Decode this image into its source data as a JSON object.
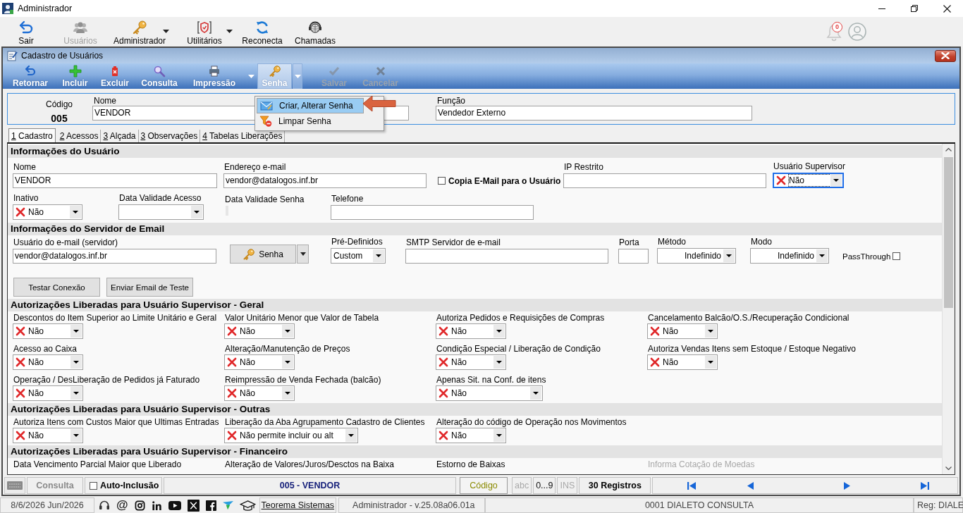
{
  "window": {
    "title": "Administrador"
  },
  "main_toolbar": [
    {
      "label": "Sair",
      "kind": "exit",
      "disabled": false,
      "has_menu": false
    },
    {
      "label": "Usuários",
      "kind": "users",
      "disabled": true,
      "has_menu": false
    },
    {
      "label": "Administrador",
      "kind": "key",
      "disabled": false,
      "has_menu": true
    },
    {
      "label": "Utilitários",
      "kind": "tools",
      "disabled": false,
      "has_menu": true
    },
    {
      "label": "Reconecta",
      "kind": "refresh",
      "disabled": false,
      "has_menu": false
    },
    {
      "label": "Chamadas",
      "kind": "support",
      "disabled": false,
      "has_menu": false
    }
  ],
  "notifications": {
    "count": "0"
  },
  "form_window": {
    "title": "Cadastro de Usuários",
    "toolbar": [
      {
        "label": "Retornar",
        "kind": "back",
        "disabled": false,
        "has_menu": false,
        "open": false
      },
      {
        "label": "Incluir",
        "kind": "add",
        "disabled": false,
        "has_menu": false,
        "open": false
      },
      {
        "label": "Excluir",
        "kind": "delete",
        "disabled": false,
        "has_menu": false,
        "open": false
      },
      {
        "label": "Consulta",
        "kind": "search",
        "disabled": false,
        "has_menu": false,
        "open": false
      },
      {
        "label": "Impressão",
        "kind": "print",
        "disabled": false,
        "has_menu": true,
        "open": false
      },
      {
        "label": "Senha",
        "kind": "key",
        "disabled": false,
        "has_menu": true,
        "open": true
      },
      {
        "label": "Salvar",
        "kind": "save",
        "disabled": true,
        "has_menu": false,
        "open": false
      },
      {
        "label": "Cancelar",
        "kind": "cancel",
        "disabled": true,
        "has_menu": false,
        "open": false
      }
    ],
    "password_menu": [
      {
        "label": "Criar, Alterar Senha",
        "kind": "mail",
        "selected": true
      },
      {
        "label": "Limpar Senha",
        "kind": "clear",
        "selected": false
      }
    ],
    "header": {
      "code_label": "Código",
      "code": "005",
      "name_label": "Nome",
      "name": "VENDOR",
      "role_label": "Função",
      "role": "Vendedor Externo"
    },
    "tabs": [
      {
        "key": "1",
        "label": "Cadastro",
        "selected": true
      },
      {
        "key": "2",
        "label": "Acessos",
        "selected": false
      },
      {
        "key": "3",
        "label": "Alçada",
        "selected": false
      },
      {
        "key": "3",
        "label": "Observações",
        "selected": false
      },
      {
        "key": "4",
        "label": "Tabelas Liberações",
        "selected": false
      }
    ],
    "user_info": {
      "title": "Informações do Usuário",
      "name": {
        "label": "Nome",
        "value": "VENDOR"
      },
      "email": {
        "label": "Endereço e-mail",
        "value": "vendor@datalogos.inf.br"
      },
      "copy_email": {
        "label": "Copia E-Mail para o Usuário",
        "checked": false
      },
      "restricted_ip": {
        "label": "IP Restrito"
      },
      "supervisor": {
        "label": "Usuário Supervisor",
        "value": "Não",
        "focused": true
      },
      "inactive": {
        "label": "Inativo",
        "value": "Não"
      },
      "access_expiry": {
        "label": "Data Validade Acesso"
      },
      "password_expiry": {
        "label": "Data Validade Senha"
      },
      "phone": {
        "label": "Telefone"
      }
    },
    "email_server": {
      "title": "Informações do Servidor de Email",
      "user": {
        "label": "Usuário do e-mail (servidor)",
        "value": "vendor@datalogos.inf.br"
      },
      "password_button": {
        "label": "Senha"
      },
      "preset": {
        "label": "Pré-Definidos",
        "value": "Custom"
      },
      "smtp": {
        "label": "SMTP Servidor de e-mail"
      },
      "port": {
        "label": "Porta"
      },
      "method": {
        "label": "Método",
        "value": "Indefinido"
      },
      "mode": {
        "label": "Modo",
        "value": "Indefinido"
      },
      "passthrough": {
        "label": "PassThrough",
        "checked": false
      },
      "buttons": [
        "Testar Conexão",
        "Enviar Email de Teste"
      ]
    },
    "authorization_sections": [
      {
        "title": "Autorizações Liberadas para Usuário Supervisor - Geral",
        "rows": [
          [
            {
              "label": "Descontos do Item Superior ao Limite Unitário e Geral",
              "value": "Não"
            },
            {
              "label": "Valor Unitário Menor que Valor de Tabela",
              "value": "Não"
            },
            {
              "label": "Autoriza Pedidos e Requisições de Compras",
              "value": "Não"
            },
            {
              "label": "Cancelamento Balcão/O.S./Recuperação Condicional",
              "value": "Não"
            }
          ],
          [
            {
              "label": "Acesso ao Caixa",
              "value": "Não"
            },
            {
              "label": "Alteração/Manutenção de Preços",
              "value": "Não"
            },
            {
              "label": "Condição Especial / Liberação de Condição",
              "value": "Não"
            },
            {
              "label": "Autoriza Vendas Itens sem Estoque / Estoque Negativo",
              "value": "Não"
            }
          ],
          [
            {
              "label": "Operação / DesLiberação de Pedidos já Faturado",
              "value": "Não"
            },
            {
              "label": "Reimpressão de Venda Fechada (balcão)",
              "value": "Não"
            },
            {
              "label": "Apenas Sit. na Conf. de itens",
              "value": "Não"
            }
          ]
        ]
      },
      {
        "title": "Autorizações Liberadas para Usuário Supervisor - Outras",
        "rows": [
          [
            {
              "label": "Autoriza Itens com Custos Maior que Ultimas Entradas",
              "value": "Não"
            },
            {
              "label": "Liberação da Aba Agrupamento Cadastro de Clientes",
              "value": "Não permite incluir ou alt"
            },
            {
              "label": "Alteração do código de Operação nos Movimentos",
              "value": "Não"
            }
          ]
        ]
      },
      {
        "title": "Autorizações Liberadas para Usuário Supervisor - Financeiro",
        "rows": [
          [
            {
              "label": "Data Vencimento Parcial Maior que Liberado",
              "disabled": false
            },
            {
              "label": "Alteração de Valores/Juros/Desctos na Baixa",
              "disabled": false
            },
            {
              "label": "Estorno de Baixas",
              "disabled": false
            },
            {
              "label": "Informa Cotação de Moedas",
              "disabled": true
            }
          ]
        ]
      }
    ],
    "record_bar": {
      "mode": "Consulta",
      "auto_insert": {
        "label": "Auto-Inclusão",
        "checked": false
      },
      "record": "005 - VENDOR",
      "order": "Código",
      "indicators": [
        {
          "label": "abc",
          "on": false
        },
        {
          "label": "0...9",
          "on": true
        },
        {
          "label": "INS",
          "on": false
        }
      ],
      "count": "30 Registros"
    }
  },
  "status_bar": {
    "date": "8/6/2026 Jun/2026",
    "at_symbol": "@",
    "link": "Teorema Sistemas",
    "user_version": "Administrador - v.25.08a06.01a",
    "company": "0001 DIALETO CONSULTA",
    "registration": "Reg: DIALE"
  }
}
